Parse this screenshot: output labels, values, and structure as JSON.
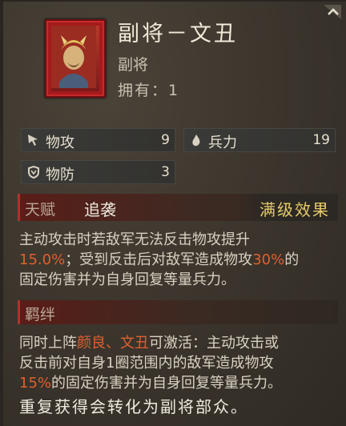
{
  "card": {
    "title": "副将－文丑",
    "subtype": "副将",
    "owned": "拥有：1",
    "portrait_frame_color": "#a51a1d"
  },
  "stats": {
    "attack": {
      "label": "物攻",
      "value": "9",
      "icon": "sword-cursor-icon"
    },
    "troops": {
      "label": "兵力",
      "value": "19",
      "icon": "blood-drop-icon"
    },
    "defense": {
      "label": "物防",
      "value": "3",
      "icon": "shield-icon"
    }
  },
  "talent": {
    "header": "天赋",
    "name": "追袭",
    "max_label": "满级效果",
    "text_1": "主动攻击时若敌军无法反击物攻提升",
    "pct_1": "15.0%",
    "text_2": "；受到反击后对敌军造成物攻",
    "pct_2": "30%",
    "text_3": "的",
    "text_4": "固定伤害并为自身回复等量兵力。"
  },
  "bond": {
    "header": "羁绊",
    "text_1": "同时上阵",
    "names": "颜良、文丑",
    "text_2": "可激活：主动攻击或",
    "text_3": "反击前对自身1圈范围内的敌军造成物攻",
    "pct": "15%",
    "text_4": "的固定伤害并为自身回复等量兵力。"
  },
  "footer": {
    "repeat_note": "重复获得会转化为副将部众。"
  },
  "colors": {
    "highlight": "#e0602e",
    "gold": "#e6cc6a",
    "accent_red": "#b0312a"
  }
}
